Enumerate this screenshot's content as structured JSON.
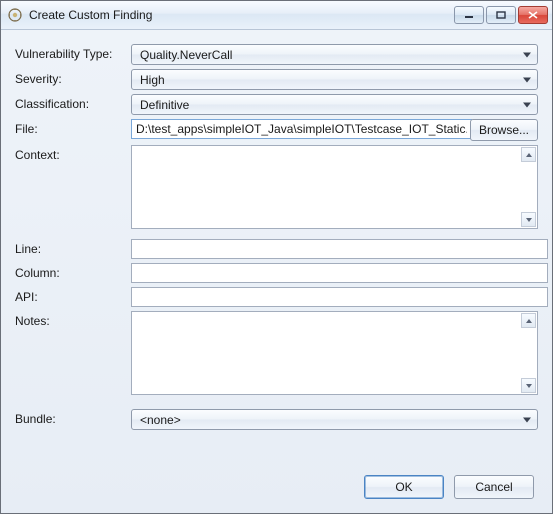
{
  "window": {
    "title": "Create Custom Finding"
  },
  "fields": {
    "vuln_type": {
      "label": "Vulnerability Type:",
      "value": "Quality.NeverCall"
    },
    "severity": {
      "label": "Severity:",
      "value": "High"
    },
    "classification": {
      "label": "Classification:",
      "value": "Definitive"
    },
    "file": {
      "label": "File:",
      "value": "D:\\test_apps\\simpleIOT_Java\\simpleIOT\\Testcase_IOT_Static.ja",
      "browse_label": "Browse..."
    },
    "context": {
      "label": "Context:",
      "value": ""
    },
    "line": {
      "label": "Line:",
      "value": ""
    },
    "column": {
      "label": "Column:",
      "value": ""
    },
    "api": {
      "label": "API:",
      "value": ""
    },
    "notes": {
      "label": "Notes:",
      "value": ""
    },
    "bundle": {
      "label": "Bundle:",
      "value": "<none>"
    }
  },
  "buttons": {
    "ok": "OK",
    "cancel": "Cancel"
  }
}
